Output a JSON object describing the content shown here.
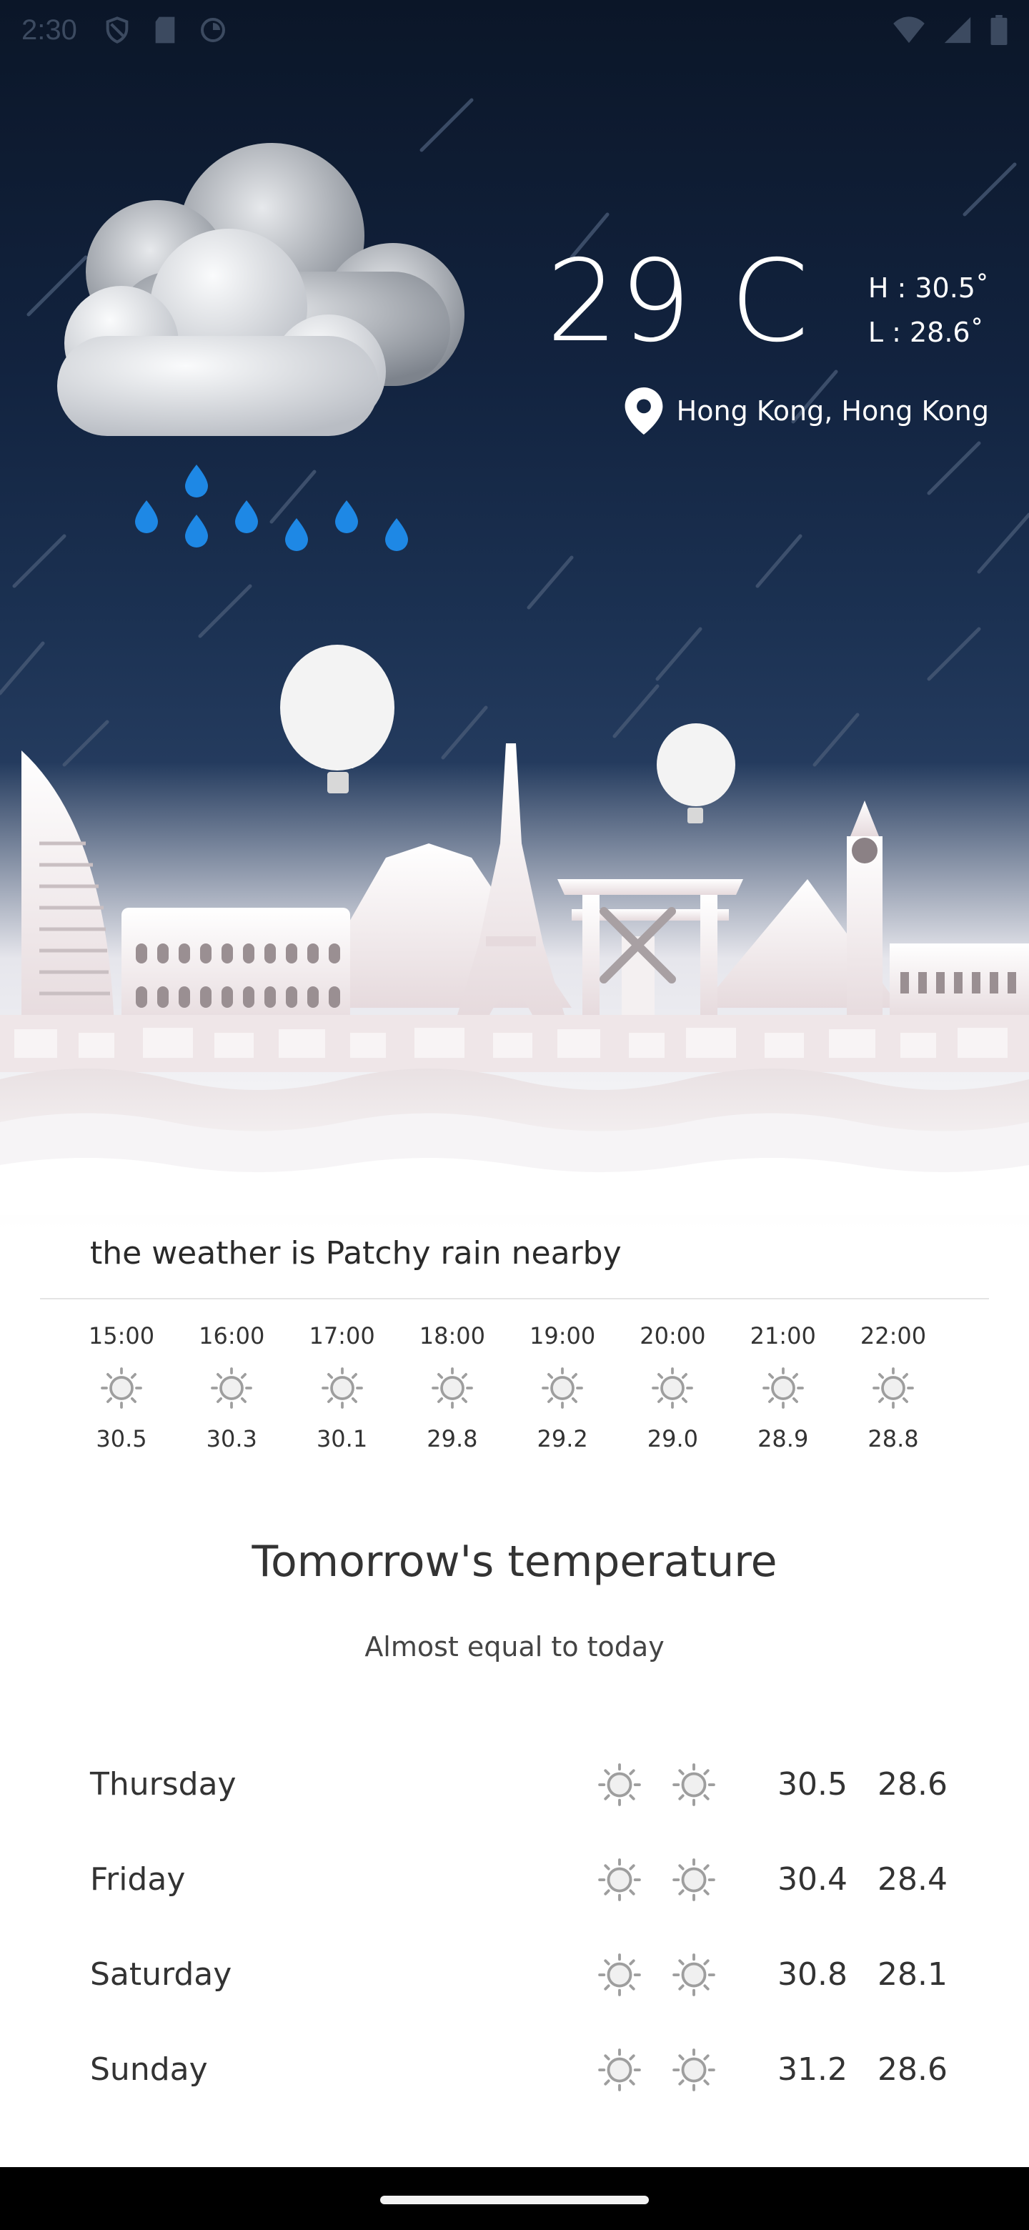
{
  "status_bar": {
    "time": "2:30",
    "left_icons": [
      "shield-icon",
      "sd-card-icon",
      "sync-circle-icon"
    ],
    "right_icons": [
      "wifi-icon",
      "signal-icon",
      "battery-icon"
    ]
  },
  "current": {
    "temperature": "29 C",
    "high": "H : 30.5˚",
    "low": "L  : 28.6˚",
    "location": "Hong Kong, Hong Kong",
    "condition_text": "the weather is Patchy rain nearby",
    "illustration": "rain-cloud-icon"
  },
  "hourly": [
    {
      "time": "15:00",
      "temp": "30.5",
      "icon": "sun-icon"
    },
    {
      "time": "16:00",
      "temp": "30.3",
      "icon": "sun-icon"
    },
    {
      "time": "17:00",
      "temp": "30.1",
      "icon": "sun-icon"
    },
    {
      "time": "18:00",
      "temp": "29.8",
      "icon": "sun-icon"
    },
    {
      "time": "19:00",
      "temp": "29.2",
      "icon": "sun-icon"
    },
    {
      "time": "20:00",
      "temp": "29.0",
      "icon": "sun-icon"
    },
    {
      "time": "21:00",
      "temp": "28.9",
      "icon": "sun-icon"
    },
    {
      "time": "22:00",
      "temp": "28.8",
      "icon": "sun-icon"
    }
  ],
  "tomorrow": {
    "title": "Tomorrow's temperature",
    "subtitle": "Almost equal to today"
  },
  "daily": [
    {
      "day": "Thursday",
      "high": "30.5",
      "low": "28.6"
    },
    {
      "day": "Friday",
      "high": "30.4",
      "low": "28.4"
    },
    {
      "day": "Saturday",
      "high": "30.8",
      "low": "28.1"
    },
    {
      "day": "Sunday",
      "high": "31.2",
      "low": "28.6"
    }
  ],
  "colors": {
    "sky_top": "#0b1628",
    "sky_mid": "#1b3152",
    "raindrop": "#1e88e5",
    "icon_gray": "#9e9e9e",
    "text": "#333333"
  }
}
